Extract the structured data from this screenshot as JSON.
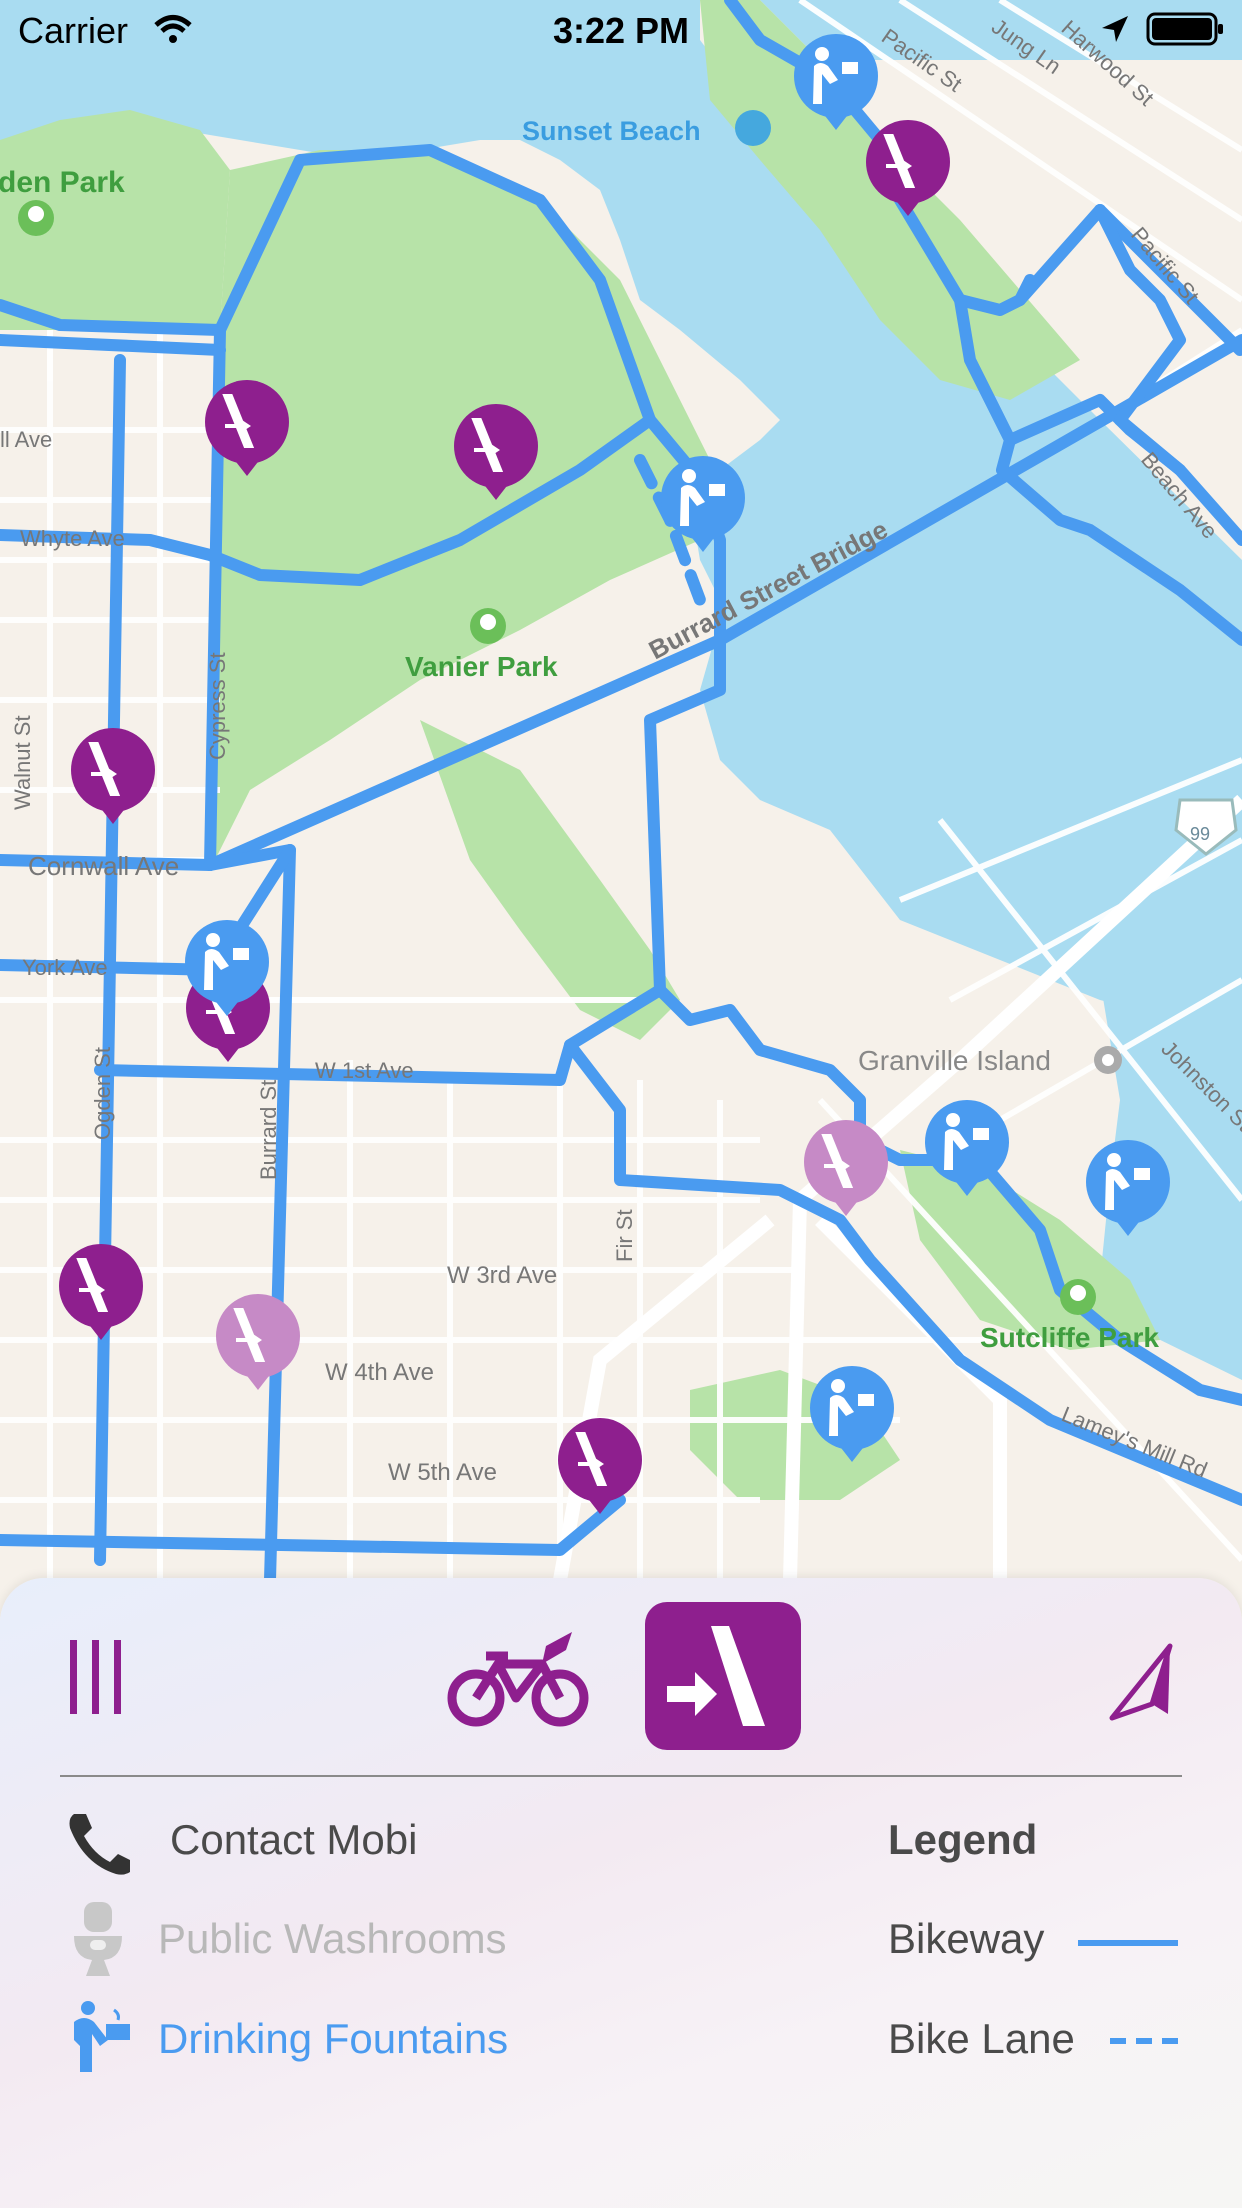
{
  "status_bar": {
    "carrier": "Carrier",
    "time": "3:22 PM"
  },
  "map": {
    "labels": {
      "sunset_beach": "Sunset Beach",
      "pacific_st": "Pacific St",
      "jung_ln": "Jung Ln",
      "harwood_st": "Harwood St",
      "den_park": "den Park",
      "vanier_park": "Vanier Park",
      "burrard_street_bridge": "Burrard Street Bridge",
      "cornwall_ave": "Cornwall Ave",
      "york_ave": "York Ave",
      "w_1st_ave": "W 1st Ave",
      "w_3rd_ave": "W 3rd Ave",
      "w_4th_ave": "W 4th Ave",
      "w_5th_ave": "W 5th Ave",
      "fir_st": "Fir St",
      "granville_island": "Granville Island",
      "johnston_st": "Johnston St",
      "sutcliffe_park": "Sutcliffe Park",
      "walnut_st": "Walnut St",
      "ll_ave": "ll Ave",
      "whyte_ave": "Whyte Ave",
      "ogden_st": "Ogden St",
      "cypress_st": "Cypress St",
      "burrard_st": "Burrard St",
      "burrard_st_sign": "99",
      "lamey_mill": "Lamey's Mill Rd",
      "beach_ave": "Beach Ave",
      "pacific_right": "Pacific St"
    },
    "colors": {
      "water": "#a9dcf1",
      "park": "#b7e3a8",
      "land": "#f6f1ea",
      "bikeway": "#4a9bf0",
      "mobi": "#8e1f8e",
      "mobi_faded": "#c68ac6",
      "fountain": "#4a9bf0"
    }
  },
  "toolbar": {
    "menu_icon": "menu-bars-icon",
    "bike_icon": "bicycle-icon",
    "mobi_icon": "mobi-station-icon",
    "locate_icon": "location-arrow-icon"
  },
  "panel": {
    "contact_label": "Contact Mobi",
    "washrooms_label": "Public Washrooms",
    "fountains_label": "Drinking Fountains",
    "legend_title": "Legend",
    "bikeway_label": "Bikeway",
    "bike_lane_label": "Bike Lane",
    "colors": {
      "contact": "#4a4a4a",
      "washrooms": "#b8b8b8",
      "fountains": "#4a9bf0",
      "legend": "#4a4a4a"
    }
  }
}
